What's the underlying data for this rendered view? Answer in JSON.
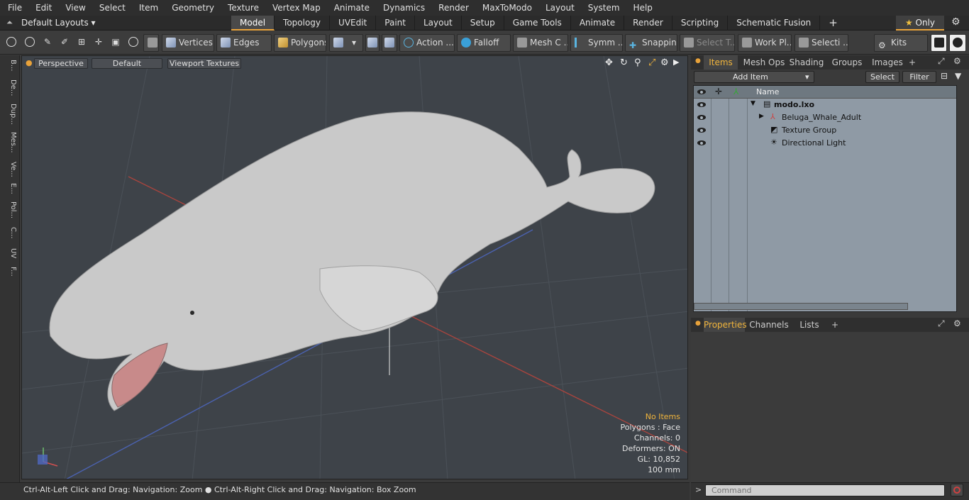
{
  "menu": [
    "File",
    "Edit",
    "View",
    "Select",
    "Item",
    "Geometry",
    "Texture",
    "Vertex Map",
    "Animate",
    "Dynamics",
    "Render",
    "MaxToModo",
    "Layout",
    "System",
    "Help"
  ],
  "layout_select": "Default Layouts",
  "layout_tabs": [
    "Model",
    "Topology",
    "UVEdit",
    "Paint",
    "Layout",
    "Setup",
    "Game Tools",
    "Animate",
    "Render",
    "Scripting",
    "Schematic Fusion"
  ],
  "only_label": "Only",
  "toolbar": {
    "vertices": "Vertices",
    "edges": "Edges",
    "polygons": "Polygons",
    "action": "Action ...",
    "falloff": "Falloff",
    "mesh": "Mesh C ...",
    "symm": "Symm ...",
    "snapping": "Snapping",
    "select_t": "Select T...",
    "workpl": "Work Pl...",
    "selecti": "Selecti ...",
    "kits": "Kits"
  },
  "left_tabs": [
    "B...",
    "De...",
    "Dup...",
    "Mes...",
    "Ve...",
    "E...",
    "Pol...",
    "C...",
    "UV",
    "F..."
  ],
  "viewport": {
    "view": "Perspective",
    "shading": "Default",
    "textures": "Viewport Textures",
    "info": {
      "no_items": "No Items",
      "polygons": "Polygons : Face",
      "channels": "Channels: 0",
      "deformers": "Deformers: ON",
      "gl": "GL: 10,852",
      "size": "100 mm"
    }
  },
  "items_panel": {
    "tabs": [
      "Items",
      "Mesh Ops",
      "Shading",
      "Groups",
      "Images"
    ],
    "add_item": "Add Item",
    "select": "Select",
    "filter": "Filter",
    "col_name": "Name",
    "rows": [
      "modo.lxo",
      "Beluga_Whale_Adult",
      "Texture Group",
      "Directional Light"
    ]
  },
  "properties_panel": {
    "tabs": [
      "Properties",
      "Channels",
      "Lists"
    ]
  },
  "status": "Ctrl-Alt-Left Click and Drag: Navigation: Zoom ● Ctrl-Alt-Right Click and Drag: Navigation: Box Zoom",
  "command_placeholder": "Command"
}
